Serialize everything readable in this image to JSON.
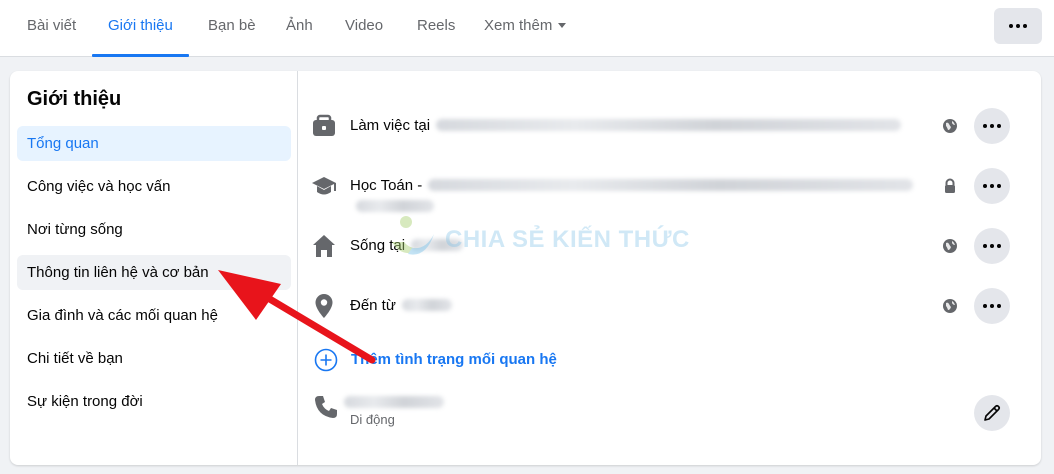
{
  "tabs": [
    {
      "label": "Bài viết"
    },
    {
      "label": "Giới thiệu"
    },
    {
      "label": "Bạn bè"
    },
    {
      "label": "Ảnh"
    },
    {
      "label": "Video"
    },
    {
      "label": "Reels"
    },
    {
      "label": "Xem thêm"
    }
  ],
  "sidebar": {
    "title": "Giới thiệu",
    "items": [
      {
        "label": "Tổng quan"
      },
      {
        "label": "Công việc và học vấn"
      },
      {
        "label": "Nơi từng sống"
      },
      {
        "label": "Thông tin liên hệ và cơ bản"
      },
      {
        "label": "Gia đình và các mối quan hệ"
      },
      {
        "label": "Chi tiết về bạn"
      },
      {
        "label": "Sự kiện trong đời"
      }
    ]
  },
  "overview": {
    "work": {
      "label": "Làm việc tại",
      "privacy": "globe-icon"
    },
    "study": {
      "label": "Học Toán -",
      "privacy": "lock-icon"
    },
    "lives": {
      "label": "Sống tại",
      "privacy": "globe-icon"
    },
    "from": {
      "label": "Đến từ",
      "privacy": "globe-icon"
    },
    "add_relationship": "Thêm tình trạng mối quan hệ",
    "phone": {
      "type_label": "Di động"
    }
  },
  "watermark": "CHIA SẺ KIẾN THỨC",
  "colors": {
    "accent": "#1877f2",
    "arrow": "#e8141b",
    "background": "#f0f2f5"
  }
}
